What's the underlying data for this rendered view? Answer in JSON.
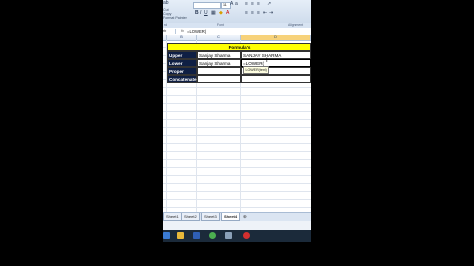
{
  "ribbon": {
    "top_labels": [
      "ab",
      "Cut",
      "Copy",
      "Format Painter"
    ],
    "font_name": "",
    "font_size": "11",
    "groups": {
      "clipboard": "rd",
      "font": "Font",
      "alignment": "Alignment"
    }
  },
  "formula_bar": {
    "name_box": "rb",
    "fx": "fx",
    "content": "=LOWER("
  },
  "columns": [
    "B",
    "C",
    "D"
  ],
  "active_column": "D",
  "sheet": {
    "header": "Formula's",
    "rows": [
      {
        "label": "Upper",
        "source": "Sanjay Sharma",
        "result": "SANJAY SHARMA"
      },
      {
        "label": "Lower",
        "source": "Sanjay Sharma",
        "result": "=LOWER("
      },
      {
        "label": "Proper",
        "source": "",
        "result": ""
      },
      {
        "label": "Concatenate",
        "source": "",
        "result": ""
      }
    ]
  },
  "tooltip": "LOWER(text)",
  "tabs": [
    "Sheet1",
    "Sheet2",
    "Sheet3",
    "Sheet4"
  ],
  "active_tab": "Sheet4",
  "taskbar_icons": [
    {
      "name": "start-icon",
      "color": "#3a7bd5"
    },
    {
      "name": "folder-icon",
      "color": "#e8b83a"
    },
    {
      "name": "media-icon",
      "color": "#2f5fb5"
    },
    {
      "name": "chrome-icon",
      "color": "#4caf50"
    },
    {
      "name": "network-icon",
      "color": "#8aa0b8"
    },
    {
      "name": "record-icon",
      "color": "#d32f2f"
    }
  ]
}
